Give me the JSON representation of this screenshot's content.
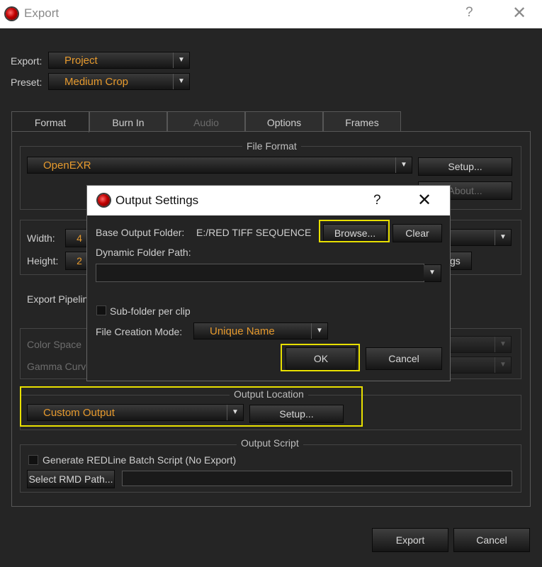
{
  "window": {
    "title": "Export",
    "help_glyph": "?",
    "close_glyph": "✕"
  },
  "export_row": {
    "label": "Export:",
    "value": "Project"
  },
  "preset_row": {
    "label": "Preset:",
    "value": "Medium Crop"
  },
  "tabs": [
    {
      "label": "Format",
      "active": true,
      "enabled": true
    },
    {
      "label": "Burn In",
      "active": false,
      "enabled": true
    },
    {
      "label": "Audio",
      "active": false,
      "enabled": false
    },
    {
      "label": "Options",
      "active": false,
      "enabled": true
    },
    {
      "label": "Frames",
      "active": false,
      "enabled": true
    }
  ],
  "file_format": {
    "title": "File Format",
    "value": "OpenEXR",
    "setup_label": "Setup...",
    "about_label": "About..."
  },
  "dimensions": {
    "width_label": "Width:",
    "width_value": "4",
    "height_label": "Height:",
    "height_value": "2",
    "settings_suffix": "gs"
  },
  "export_pipeline": {
    "label": "Export Pipeline"
  },
  "color": {
    "color_space_label": "Color Space",
    "gamma_curve_label": "Gamma Curve"
  },
  "output_location": {
    "title": "Output Location",
    "value": "Custom Output",
    "setup_label": "Setup..."
  },
  "output_script": {
    "title": "Output Script",
    "checkbox_label": "Generate REDLine Batch Script (No Export)",
    "select_rmd_label": "Select RMD Path...",
    "rmd_path_value": ""
  },
  "footer": {
    "export_label": "Export",
    "cancel_label": "Cancel"
  },
  "dialog": {
    "title": "Output Settings",
    "help_glyph": "?",
    "close_glyph": "✕",
    "base_folder_label": "Base Output Folder:",
    "base_folder_value": "E:/RED TIFF SEQUENCE",
    "browse_label": "Browse...",
    "clear_label": "Clear",
    "dynamic_folder_label": "Dynamic Folder Path:",
    "dynamic_folder_value": "",
    "subfolder_label": "Sub-folder per clip",
    "file_creation_label": "File Creation Mode:",
    "file_creation_value": "Unique Name",
    "ok_label": "OK",
    "cancel_label": "Cancel"
  },
  "colors": {
    "accent_orange": "#e69a2e",
    "highlight_yellow": "#e8e000",
    "background": "#252525"
  },
  "icons": {
    "app": "red-record-icon",
    "dropdown": "triangle-down-icon"
  }
}
